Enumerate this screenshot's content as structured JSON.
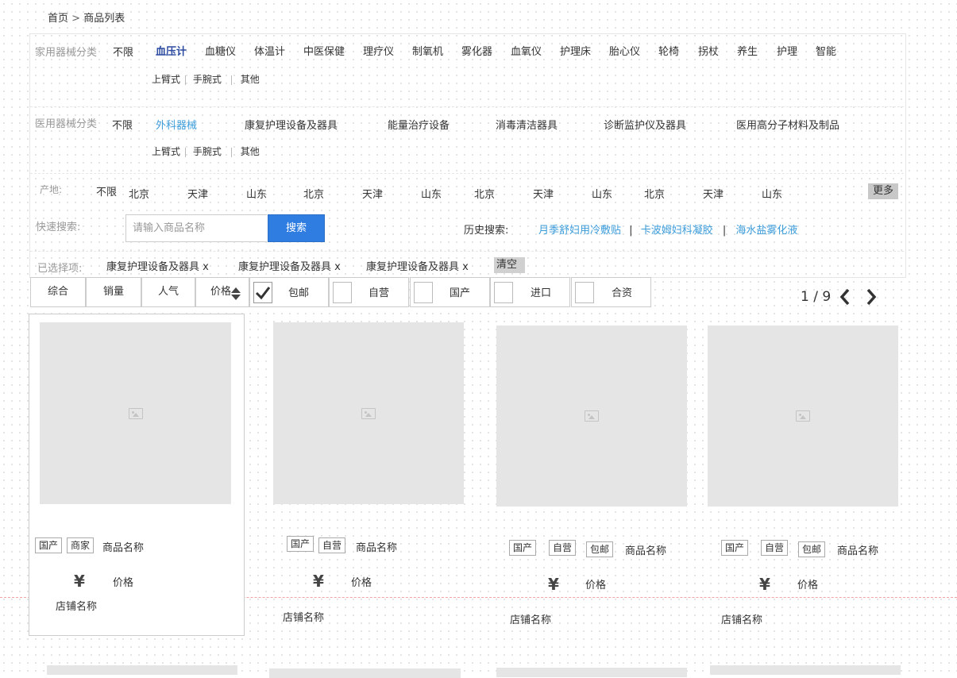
{
  "breadcrumb": {
    "home": "首页",
    "sep": ">",
    "current": "商品列表"
  },
  "household": {
    "label": "家用器械分类",
    "unlimited": "不限",
    "items": [
      "血压计",
      "血糖仪",
      "体温计",
      "中医保健",
      "理疗仪",
      "制氧机",
      "雾化器",
      "血氧仪",
      "护理床",
      "胎心仪",
      "轮椅",
      "拐杖",
      "养生",
      "护理",
      "智能"
    ],
    "active_index": 0,
    "sub": [
      "上臂式",
      "手腕式",
      "其他"
    ]
  },
  "medical": {
    "label": "医用器械分类",
    "unlimited": "不限",
    "items": [
      "外科器械",
      "康复护理设备及器具",
      "能量治疗设备",
      "消毒清洁器具",
      "诊断监护仪及器具",
      "医用高分子材料及制品"
    ],
    "active_index": 0,
    "sub": [
      "上臂式",
      "手腕式",
      "其他"
    ]
  },
  "origin": {
    "label": "产地:",
    "unlimited": "不限",
    "items": [
      "北京",
      "天津",
      "山东",
      "北京",
      "天津",
      "山东",
      "北京",
      "天津",
      "山东",
      "北京",
      "天津",
      "山东"
    ],
    "more": "更多"
  },
  "search": {
    "label": "快速搜索:",
    "placeholder": "请输入商品名称",
    "button": "搜索",
    "history_label": "历史搜索:",
    "history": [
      "月季舒妇用冷敷贴",
      "卡波姆妇科凝胶",
      "海水盐雾化液"
    ],
    "history_sep": "|"
  },
  "selected": {
    "label": "已选择项:",
    "items": [
      "康复护理设备及器具 x",
      "康复护理设备及器具 x",
      "康复护理设备及器具 x"
    ],
    "clear": "清空"
  },
  "sort": [
    "综合",
    "销量",
    "人气",
    "价格"
  ],
  "filters": [
    {
      "label": "包邮",
      "checked": true
    },
    {
      "label": "自营",
      "checked": false
    },
    {
      "label": "国产",
      "checked": false
    },
    {
      "label": "进口",
      "checked": false
    },
    {
      "label": "合资",
      "checked": false
    }
  ],
  "pager": {
    "text": "1 / 9"
  },
  "products": [
    {
      "tags": [
        "国产",
        "商家"
      ],
      "name": "商品名称",
      "currency": "¥",
      "price": "价格",
      "shop": "店铺名称"
    },
    {
      "tags": [
        "国产",
        "自营"
      ],
      "name": "商品名称",
      "currency": "¥",
      "price": "价格",
      "shop": "店铺名称"
    },
    {
      "tags": [
        "国产",
        "自营",
        "包邮"
      ],
      "name": "商品名称",
      "currency": "¥",
      "price": "价格",
      "shop": "店铺名称"
    },
    {
      "tags": [
        "国产",
        "自营",
        "包邮"
      ],
      "name": "商品名称",
      "currency": "¥",
      "price": "价格",
      "shop": "店铺名称"
    }
  ],
  "colors": {
    "accent": "#2f7de1",
    "active_category": "#2b4aa0",
    "link": "#3a9bd9",
    "red_dash": "#f2a3a3"
  }
}
